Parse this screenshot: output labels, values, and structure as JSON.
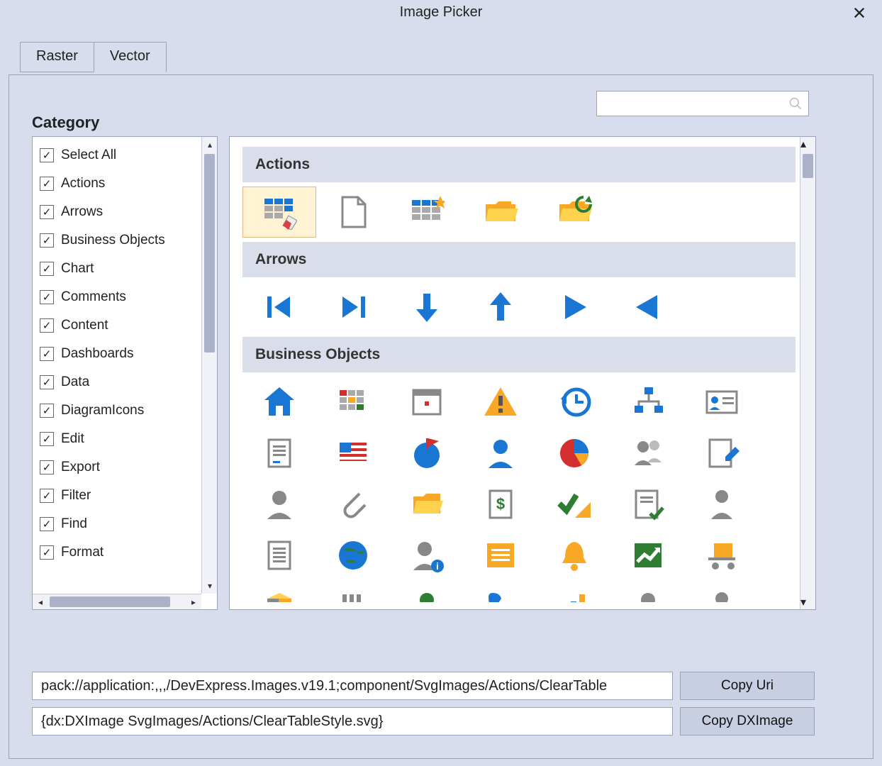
{
  "window": {
    "title": "Image Picker"
  },
  "tabs": [
    {
      "label": "Raster",
      "active": false
    },
    {
      "label": "Vector",
      "active": true
    }
  ],
  "search": {
    "placeholder": ""
  },
  "category": {
    "label": "Category",
    "items": [
      {
        "label": "Select All",
        "checked": true
      },
      {
        "label": "Actions",
        "checked": true
      },
      {
        "label": "Arrows",
        "checked": true
      },
      {
        "label": "Business Objects",
        "checked": true
      },
      {
        "label": "Chart",
        "checked": true
      },
      {
        "label": "Comments",
        "checked": true
      },
      {
        "label": "Content",
        "checked": true
      },
      {
        "label": "Dashboards",
        "checked": true
      },
      {
        "label": "Data",
        "checked": true
      },
      {
        "label": "DiagramIcons",
        "checked": true
      },
      {
        "label": "Edit",
        "checked": true
      },
      {
        "label": "Export",
        "checked": true
      },
      {
        "label": "Filter",
        "checked": true
      },
      {
        "label": "Find",
        "checked": true
      },
      {
        "label": "Format",
        "checked": true
      }
    ]
  },
  "groups": [
    {
      "title": "Actions",
      "icons": [
        {
          "name": "clear-table-style-icon",
          "selected": true,
          "svg": "clear-table"
        },
        {
          "name": "new-file-icon",
          "selected": false,
          "svg": "file-blank"
        },
        {
          "name": "new-grid-icon",
          "selected": false,
          "svg": "grid-star"
        },
        {
          "name": "open-folder-icon",
          "selected": false,
          "svg": "folder-open"
        },
        {
          "name": "refresh-folder-icon",
          "selected": false,
          "svg": "folder-refresh"
        }
      ]
    },
    {
      "title": "Arrows",
      "icons": [
        {
          "name": "first-icon",
          "svg": "arrow-first"
        },
        {
          "name": "last-icon",
          "svg": "arrow-last"
        },
        {
          "name": "down-icon",
          "svg": "arrow-down"
        },
        {
          "name": "up-icon",
          "svg": "arrow-up"
        },
        {
          "name": "play-icon",
          "svg": "arrow-right"
        },
        {
          "name": "play-left-icon",
          "svg": "arrow-left"
        }
      ]
    },
    {
      "title": "Business Objects",
      "icons": [
        {
          "name": "home-icon",
          "svg": "home"
        },
        {
          "name": "grid-color-icon",
          "svg": "color-grid"
        },
        {
          "name": "calendar-icon",
          "svg": "calendar"
        },
        {
          "name": "warning-icon",
          "svg": "warning"
        },
        {
          "name": "history-icon",
          "svg": "history"
        },
        {
          "name": "org-chart-icon",
          "svg": "orgchart"
        },
        {
          "name": "id-card-icon",
          "svg": "idcard"
        },
        {
          "name": "document-lines-icon",
          "svg": "doc-lines"
        },
        {
          "name": "flag-us-icon",
          "svg": "flag-us"
        },
        {
          "name": "globe-flag-icon",
          "svg": "globe-flag"
        },
        {
          "name": "person-blue-icon",
          "svg": "person-blue"
        },
        {
          "name": "pie-chart-icon",
          "svg": "pie"
        },
        {
          "name": "people-icon",
          "svg": "people"
        },
        {
          "name": "edit-doc-icon",
          "svg": "edit-doc"
        },
        {
          "name": "user-gray-icon",
          "svg": "user-gray"
        },
        {
          "name": "paperclip-icon",
          "svg": "paperclip"
        },
        {
          "name": "folder-yellow-icon",
          "svg": "folder-yellow"
        },
        {
          "name": "invoice-icon",
          "svg": "invoice"
        },
        {
          "name": "checks-icon",
          "svg": "checks"
        },
        {
          "name": "doc-check-icon",
          "svg": "doc-check"
        },
        {
          "name": "business-person-icon",
          "svg": "suit"
        },
        {
          "name": "doc-text-icon",
          "svg": "doc-text"
        },
        {
          "name": "globe-icon",
          "svg": "globe"
        },
        {
          "name": "user-info-icon",
          "svg": "user-info"
        },
        {
          "name": "list-orange-icon",
          "svg": "list-orange"
        },
        {
          "name": "bell-icon",
          "svg": "bell"
        },
        {
          "name": "stock-up-icon",
          "svg": "stock-up"
        },
        {
          "name": "cart-icon",
          "svg": "cart"
        },
        {
          "name": "package-icon",
          "svg": "package"
        },
        {
          "name": "factory-icon",
          "svg": "factory"
        },
        {
          "name": "user-green-icon",
          "svg": "user-green"
        },
        {
          "name": "phone-icon",
          "svg": "phone"
        },
        {
          "name": "bar-chart-icon",
          "svg": "bars"
        },
        {
          "name": "user-gray2-icon",
          "svg": "user-gray"
        },
        {
          "name": "user-tie-icon",
          "svg": "user-tie"
        }
      ]
    }
  ],
  "uri": {
    "value": "pack://application:,,,/DevExpress.Images.v19.1;component/SvgImages/Actions/ClearTable",
    "dximage": "{dx:DXImage SvgImages/Actions/ClearTableStyle.svg}",
    "copy_uri_label": "Copy Uri",
    "copy_dximage_label": "Copy DXImage"
  }
}
